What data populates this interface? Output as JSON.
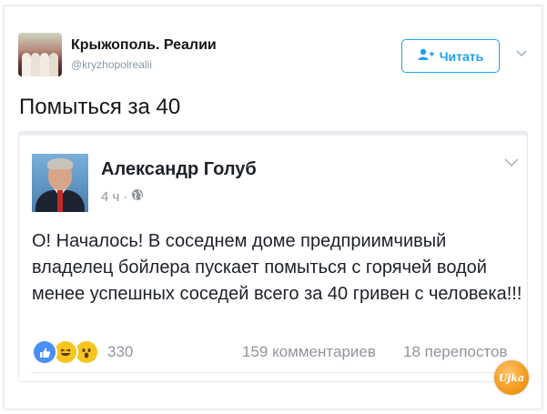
{
  "account": {
    "name": "Крыжополь. Реалии",
    "handle": "@kryzhopolrealii",
    "follow_label": "Читать"
  },
  "tweet": {
    "text": "Помыться за 40"
  },
  "embedded_post": {
    "author": "Александр Голуб",
    "time": "4 ч",
    "dot": "·",
    "body": "О! Началось! В  соседнем доме предприимчивый владелец бойлера пускает помыться с горячей водой менее успешных соседей всего за 40 гривен с человека!!!",
    "reactions": [
      "like-icon",
      "haha-icon",
      "wow-icon"
    ],
    "reactions_count": "330",
    "comments": "159 комментариев",
    "shares": "18 перепостов"
  },
  "watermark": {
    "text": "Ujka"
  },
  "colors": {
    "twitter_blue": "#1da1f2",
    "facebook_like": "#4a8ff3",
    "muted": "#90949c"
  }
}
